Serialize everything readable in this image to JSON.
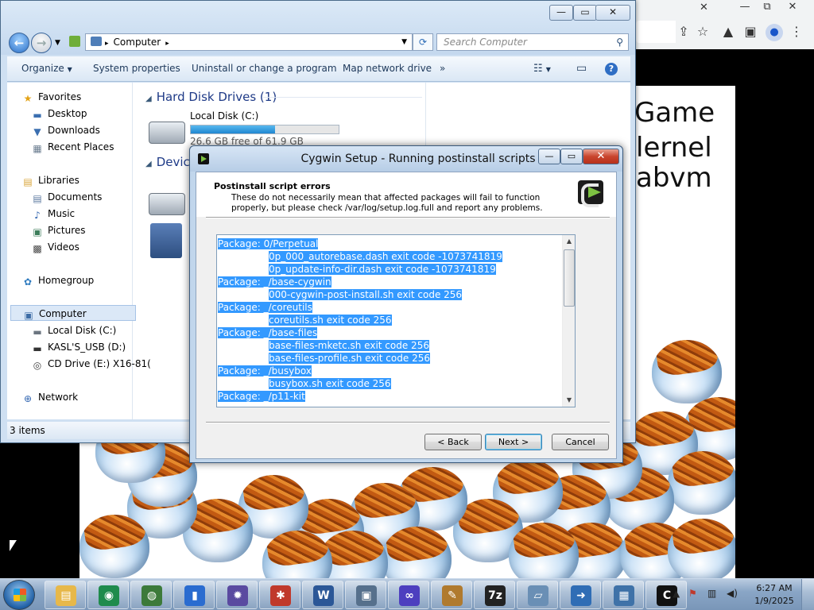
{
  "browser": {
    "minimize": "—",
    "restore": "⧉",
    "close": "✕"
  },
  "webpage": {
    "lines": [
      "Game",
      "lernel",
      "abvm"
    ]
  },
  "explorer": {
    "address": {
      "location": "Computer",
      "search_placeholder": "Search Computer"
    },
    "toolbar": {
      "organize": "Organize",
      "system_properties": "System properties",
      "uninstall": "Uninstall or change a program",
      "map_drive": "Map network drive",
      "more": "»"
    },
    "nav": {
      "favorites": "Favorites",
      "desktop": "Desktop",
      "downloads": "Downloads",
      "recent_places": "Recent Places",
      "libraries": "Libraries",
      "documents": "Documents",
      "music": "Music",
      "pictures": "Pictures",
      "videos": "Videos",
      "homegroup": "Homegroup",
      "computer": "Computer",
      "local_disk": "Local Disk (C:)",
      "usb": "KASL'S_USB (D:)",
      "cd_drive": "CD Drive (E:) X16-81(",
      "network": "Network"
    },
    "groups": {
      "hard_disks": "Hard Disk Drives (1)",
      "devices": "Devices"
    },
    "drive_c": {
      "label": "Local Disk (C:)",
      "free_text": "26.6 GB free of 61.9 GB",
      "used_fraction": 0.57
    },
    "status": "3 items"
  },
  "cygwin": {
    "title": "Cygwin Setup - Running postinstall scripts",
    "header_title": "Postinstall script errors",
    "header_sub_1": "These do not necessarily mean that affected packages will fail to function",
    "header_sub_2": "properly, but please check /var/log/setup.log.full and report any problems.",
    "log": [
      {
        "kind": "pkg",
        "text": "Package: 0/Perpetual"
      },
      {
        "kind": "item",
        "text": "0p_000_autorebase.dash exit code -1073741819"
      },
      {
        "kind": "item",
        "text": "0p_update-info-dir.dash exit code -1073741819"
      },
      {
        "kind": "pkg",
        "text": "Package: _/base-cygwin"
      },
      {
        "kind": "item",
        "text": "000-cygwin-post-install.sh exit code 256"
      },
      {
        "kind": "pkg",
        "text": "Package: _/coreutils"
      },
      {
        "kind": "item",
        "text": "coreutils.sh exit code 256"
      },
      {
        "kind": "pkg",
        "text": "Package: _/base-files"
      },
      {
        "kind": "item",
        "text": "base-files-mketc.sh exit code 256"
      },
      {
        "kind": "item",
        "text": "base-files-profile.sh exit code 256"
      },
      {
        "kind": "pkg",
        "text": "Package: _/busybox"
      },
      {
        "kind": "item",
        "text": "busybox.sh exit code 256"
      },
      {
        "kind": "pkg",
        "text": "Package: _/p11-kit"
      }
    ],
    "buttons": {
      "back": "< Back",
      "next": "Next >",
      "cancel": "Cancel"
    }
  },
  "taskbar": {
    "apps": [
      {
        "name": "windows-explorer",
        "glyph": "▤",
        "color": "#e7b84a"
      },
      {
        "name": "app-green-circle",
        "glyph": "◉",
        "color": "#1f8b4c"
      },
      {
        "name": "app-globe",
        "glyph": "◍",
        "color": "#3c7a3a"
      },
      {
        "name": "app-blue-bottle",
        "glyph": "▮",
        "color": "#2a6cd0"
      },
      {
        "name": "app-purple-star",
        "glyph": "✹",
        "color": "#5a4aa0"
      },
      {
        "name": "app-red-figure",
        "glyph": "✱",
        "color": "#c0392b"
      },
      {
        "name": "microsoft-word",
        "glyph": "W",
        "color": "#2b5797"
      },
      {
        "name": "app-shield-pc",
        "glyph": "▣",
        "color": "#56708c"
      },
      {
        "name": "app-infinity",
        "glyph": "∞",
        "color": "#4d3fbf"
      },
      {
        "name": "app-paint",
        "glyph": "✎",
        "color": "#b07a2e"
      },
      {
        "name": "7zip",
        "glyph": "7z",
        "color": "#222222"
      },
      {
        "name": "app-notepad",
        "glyph": "▱",
        "color": "#6a8fb5"
      },
      {
        "name": "app-arrow",
        "glyph": "➜",
        "color": "#2f6db5"
      },
      {
        "name": "app-remote",
        "glyph": "▦",
        "color": "#3f72a8"
      },
      {
        "name": "cygwin-setup",
        "glyph": "C",
        "color": "#111111"
      }
    ],
    "clock_time": "6:27 AM",
    "clock_date": "1/9/2025"
  }
}
